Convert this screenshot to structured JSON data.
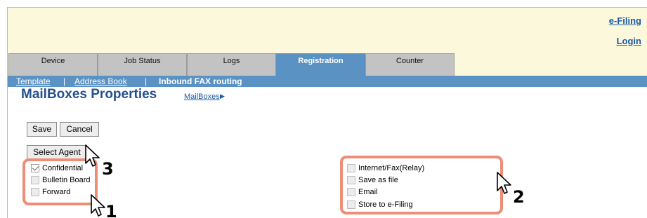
{
  "header": {
    "efiling_link": "e-Filing",
    "login_link": "Login"
  },
  "tabs": [
    {
      "label": "Device",
      "active": false
    },
    {
      "label": "Job Status",
      "active": false
    },
    {
      "label": "Logs",
      "active": false
    },
    {
      "label": "Registration",
      "active": true
    },
    {
      "label": "Counter",
      "active": false
    }
  ],
  "subnav": {
    "items": [
      {
        "label": "Template",
        "current": false
      },
      {
        "label": "Address Book",
        "current": false
      },
      {
        "label": "Inbound FAX routing",
        "current": true
      }
    ],
    "separator": "|"
  },
  "page": {
    "title": "MailBoxes Properties",
    "breadcrumb": "MailBoxes",
    "breadcrumb_arrow": "▶"
  },
  "buttons": {
    "save": "Save",
    "cancel": "Cancel",
    "select_agent": "Select Agent"
  },
  "agents_left": [
    {
      "label": "Confidential",
      "checked": true
    },
    {
      "label": "Bulletin Board",
      "checked": false
    },
    {
      "label": "Forward",
      "checked": false
    }
  ],
  "agents_right": [
    {
      "label": "Internet/Fax(Relay)",
      "checked": false
    },
    {
      "label": "Save as file",
      "checked": false
    },
    {
      "label": "Email",
      "checked": false
    },
    {
      "label": "Store to e-Filing",
      "checked": false
    }
  ],
  "annotations": {
    "step1": "1",
    "step2": "2",
    "step3": "3"
  },
  "colors": {
    "header_bg": "#fbf8dc",
    "accent_blue": "#5b92c4",
    "tab_grey": "#c3c3c3",
    "title_blue": "#25508f",
    "link_blue": "#1a5aa8",
    "callout": "#ec8e78"
  }
}
